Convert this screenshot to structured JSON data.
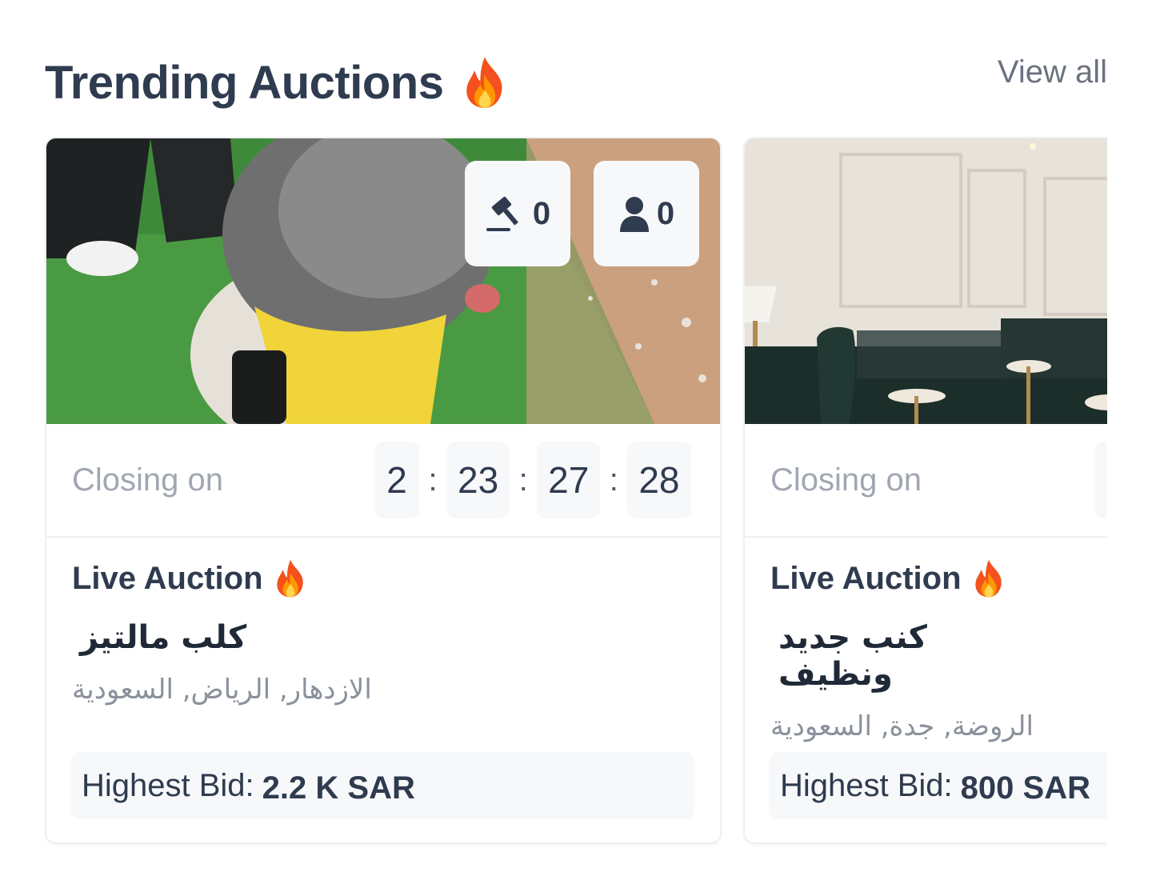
{
  "header": {
    "title": "Trending Auctions",
    "title_icon": "fire-emoji",
    "view_all": "View all"
  },
  "cards": [
    {
      "bid_count": "0",
      "bidder_count": "0",
      "closing_label": "Closing on",
      "countdown": [
        "2",
        "23",
        "27",
        "28"
      ],
      "status": "Live Auction",
      "title": "كلب مالتيز",
      "location": "الازدهار, الرياض, السعودية",
      "highest_bid_label": "Highest Bid:",
      "highest_bid_value": "2.2 K SAR"
    },
    {
      "closing_label": "Closing on",
      "status": "Live Auction",
      "title": "كنب جديد ونظيف",
      "location": "الروضة, جدة, السعودية",
      "highest_bid_label": "Highest Bid:",
      "highest_bid_value": "800 SAR"
    }
  ],
  "colors": {
    "heading": "#2f3b4f",
    "muted": "#a0a7b3",
    "panel": "#f7f8fa",
    "border": "#eef0f3"
  }
}
